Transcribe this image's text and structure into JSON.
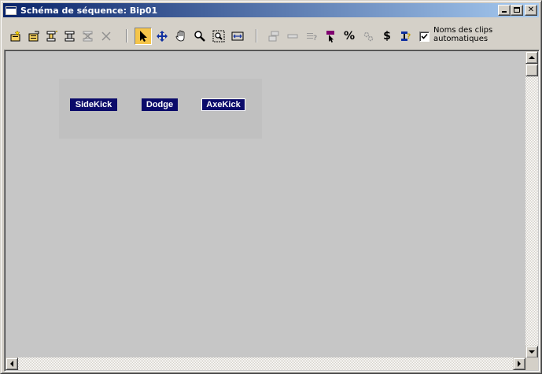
{
  "window": {
    "title": "Schéma de séquence: Bip01",
    "titlebar_colors": [
      "#0a246a",
      "#a6caf0"
    ]
  },
  "toolbar": {
    "icons": [
      "new-clip-icon",
      "open-clip-icon",
      "insert-clip-icon",
      "insert-group-icon",
      "delete-group-icon",
      "delete-icon",
      "select-arrow-icon",
      "move-icon",
      "pan-hand-icon",
      "zoom-icon",
      "zoom-region-icon",
      "zoom-extents-icon",
      "clip-info-icon",
      "transition-icon",
      "properties-icon",
      "select-color-icon",
      "percent-icon",
      "optimize-icon",
      "cost-icon",
      "random-transition-icon"
    ],
    "percent_label": "%",
    "cost_label": "$",
    "auto_clip_names": {
      "label": "Noms des clips automatiques",
      "checked": true
    }
  },
  "canvas": {
    "background": "#c6c6c6",
    "clips": [
      {
        "label": "SideKick",
        "selected": false
      },
      {
        "label": "Dodge",
        "selected": false
      },
      {
        "label": "AxeKick",
        "selected": true
      }
    ],
    "clip_color": "#0b0b6a"
  }
}
